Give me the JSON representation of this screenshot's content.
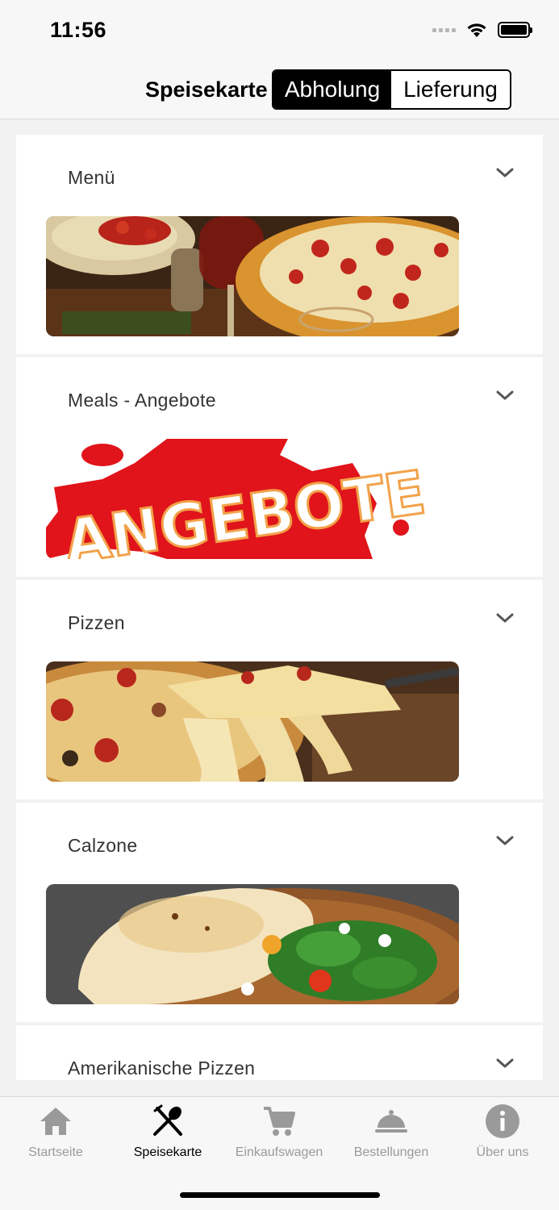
{
  "status_bar": {
    "time": "11:56"
  },
  "header": {
    "title": "Speisekarte",
    "segments": [
      {
        "label": "Abholung",
        "selected": true
      },
      {
        "label": "Lieferung",
        "selected": false
      }
    ]
  },
  "categories": [
    {
      "label": "Menü",
      "image": "pasta-wine-pizza-photo"
    },
    {
      "label": "Meals - Angebote",
      "image": "angebote-splash-graphic",
      "image_text": "ANGEBOTE"
    },
    {
      "label": "Pizzen",
      "image": "cheese-pizza-slice-photo"
    },
    {
      "label": "Calzone",
      "image": "calzone-salad-photo"
    },
    {
      "label": "Amerikanische Pizzen",
      "image": "american-pizza-photo"
    }
  ],
  "tab_bar": {
    "tabs": [
      {
        "label": "Startseite",
        "icon": "home-icon",
        "active": false
      },
      {
        "label": "Speisekarte",
        "icon": "cutlery-icon",
        "active": true
      },
      {
        "label": "Einkaufswagen",
        "icon": "cart-icon",
        "active": false
      },
      {
        "label": "Bestellungen",
        "icon": "cloche-icon",
        "active": false
      },
      {
        "label": "Über uns",
        "icon": "info-icon",
        "active": false
      }
    ]
  },
  "colors": {
    "accent": "#000000",
    "inactive_tab": "#9a9a9a",
    "splash_red": "#e0141a"
  }
}
